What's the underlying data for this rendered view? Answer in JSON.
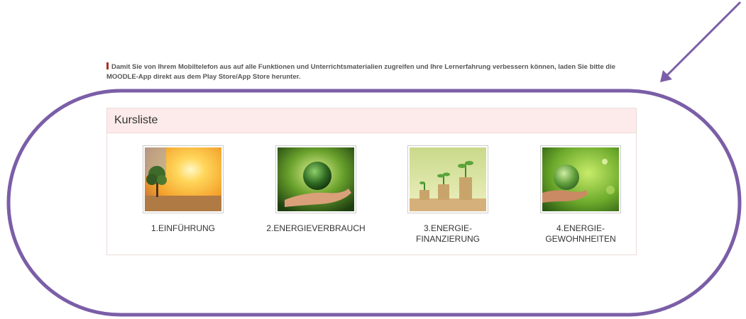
{
  "notice": {
    "text": "Damit Sie von Ihrem Mobiltelefon aus auf alle Funktionen und Unterrichtsmaterialien zugreifen und Ihre Lernerfahrung verbessern können, laden Sie bitte die MOODLE-App direkt aus dem Play Store/App Store herunter."
  },
  "course_list": {
    "title": "Kursliste",
    "courses": [
      {
        "line1": "1.EINFÜHRUNG",
        "line2": "",
        "image": "sunset-tree-image"
      },
      {
        "line1": "2.ENERGIEVERBRAUCH",
        "line2": "",
        "image": "earth-in-hand-image"
      },
      {
        "line1": "3.ENERGIE-",
        "line2": "FINANZIERUNG",
        "image": "coin-plants-image"
      },
      {
        "line1": "4.ENERGIE-",
        "line2": "GEWOHNHEITEN",
        "image": "glass-globe-hand-image"
      }
    ]
  },
  "annotation": {
    "color": "#7b5ea7"
  }
}
